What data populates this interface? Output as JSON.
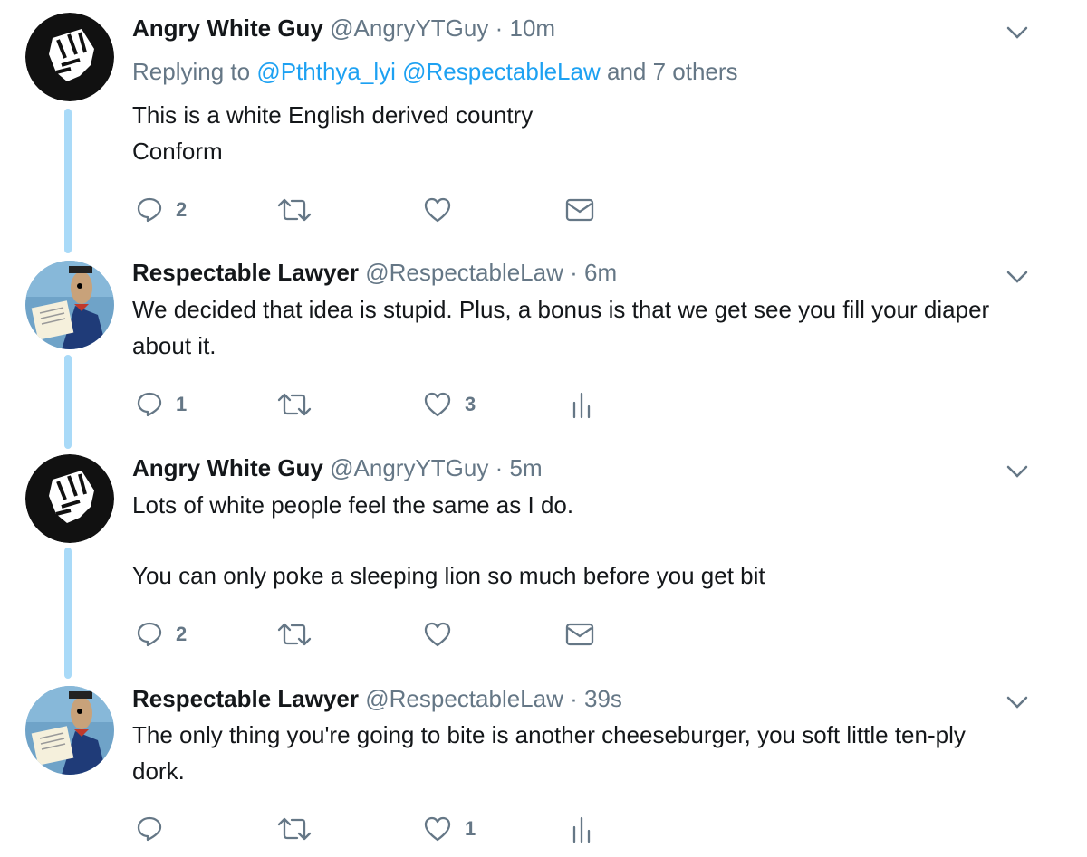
{
  "thread": [
    {
      "author": {
        "name": "Angry White Guy",
        "handle": "@AngryYTGuy",
        "time": "· 10m",
        "avatar": "fist-avatar"
      },
      "reply_to": {
        "prefix": "Replying to",
        "mention1": "@Pththya_lyi",
        "mention2": "@RespectableLaw",
        "suffix": "and 7 others"
      },
      "text": [
        "This is a white English derived country",
        "Conform"
      ],
      "actions": {
        "reply_count": "2",
        "retweet_count": "",
        "like_count": "",
        "last_action": "dm-envelope-icon"
      }
    },
    {
      "author": {
        "name": "Respectable Lawyer",
        "handle": "@RespectableLaw",
        "time": "· 6m",
        "avatar": "cartoon-lawyer-avatar"
      },
      "text": [
        "We decided that idea is stupid. Plus, a bonus is that we get see you fill your diaper about it."
      ],
      "actions": {
        "reply_count": "1",
        "retweet_count": "",
        "like_count": "3",
        "last_action": "analytics-icon"
      }
    },
    {
      "author": {
        "name": "Angry White Guy",
        "handle": "@AngryYTGuy",
        "time": "· 5m",
        "avatar": "fist-avatar"
      },
      "text": [
        "Lots of white people feel the same as I do.",
        "You can only poke a sleeping lion so much before you get bit"
      ],
      "actions": {
        "reply_count": "2",
        "retweet_count": "",
        "like_count": "",
        "last_action": "dm-envelope-icon"
      }
    },
    {
      "author": {
        "name": "Respectable Lawyer",
        "handle": "@RespectableLaw",
        "time": "· 39s",
        "avatar": "cartoon-lawyer-avatar"
      },
      "text": [
        "The only thing you're going to bite is another cheeseburger, you soft little ten-ply dork."
      ],
      "actions": {
        "reply_count": "",
        "retweet_count": "",
        "like_count": "1",
        "last_action": "analytics-icon"
      }
    }
  ],
  "colors": {
    "text": "#14171a",
    "muted": "#657786",
    "link": "#1da1f2",
    "thread_line": "#a9daf8"
  }
}
